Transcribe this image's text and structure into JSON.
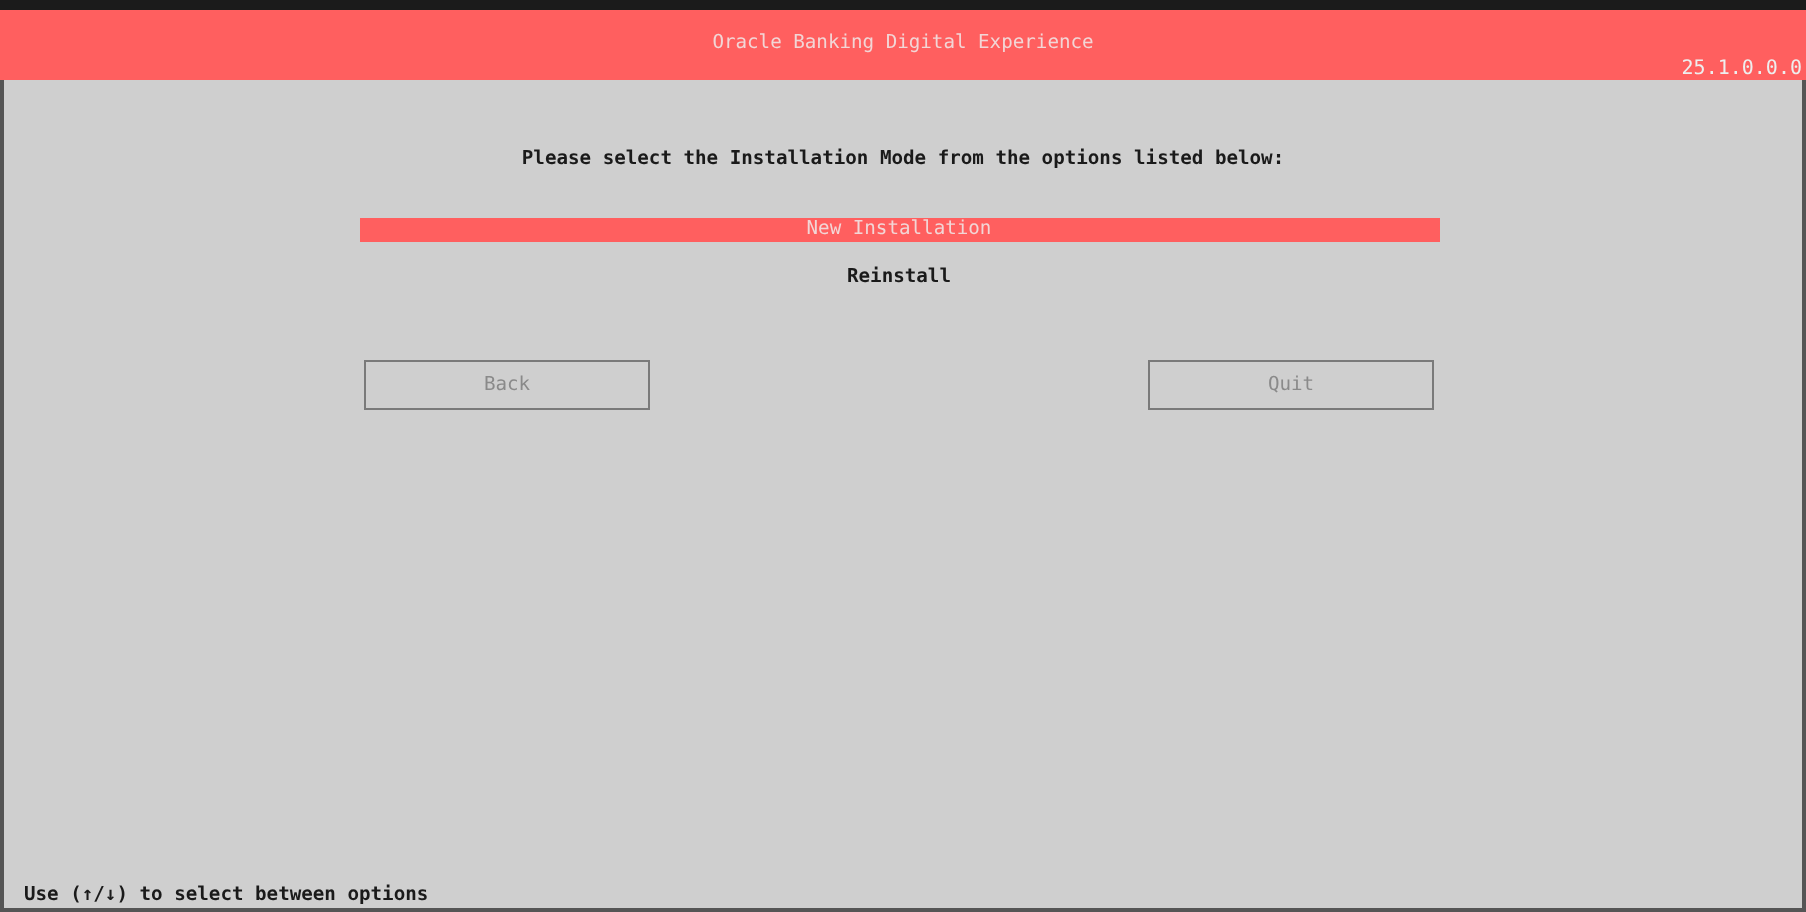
{
  "header": {
    "title": "Oracle Banking Digital Experience",
    "version": "25.1.0.0.0"
  },
  "prompt": "Please select the Installation Mode from the options listed below:",
  "options": [
    {
      "label": "New Installation",
      "selected": true
    },
    {
      "label": "Reinstall",
      "selected": false
    }
  ],
  "buttons": [
    {
      "label": "Back",
      "disabled": true
    },
    {
      "label": "Quit",
      "disabled": true
    }
  ],
  "status_bar": "Use (↑/↓) to select between options"
}
